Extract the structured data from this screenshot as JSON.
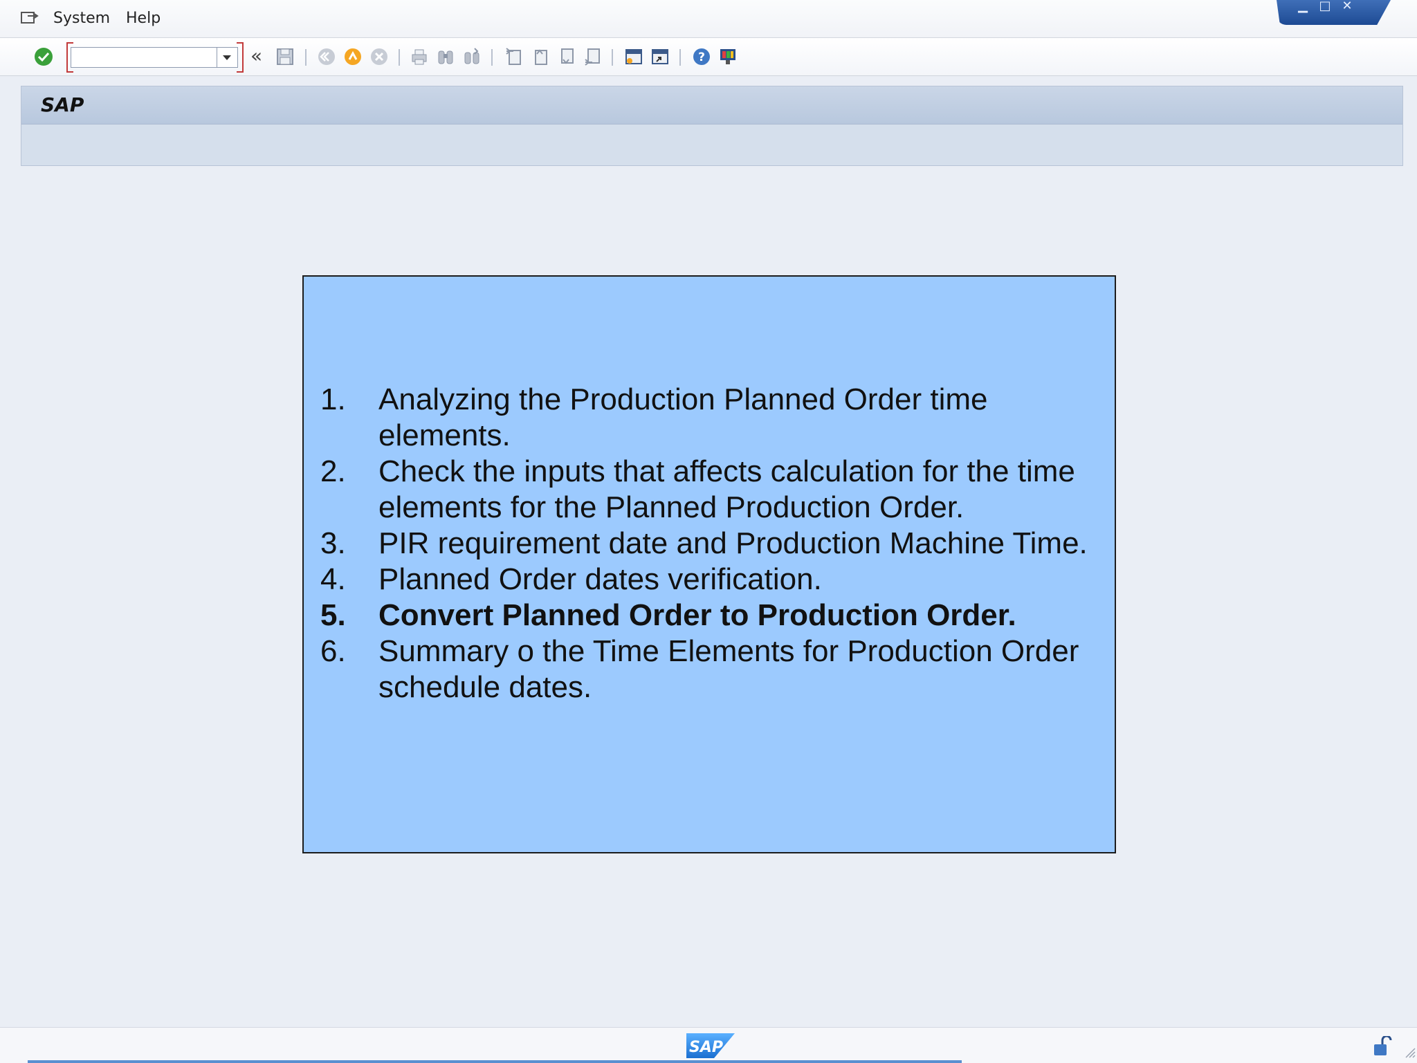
{
  "menubar": {
    "items": [
      {
        "label": "System"
      },
      {
        "label": "Help"
      }
    ]
  },
  "toolbar": {
    "command_field": {
      "value": "",
      "placeholder": ""
    },
    "icons": [
      "enter-icon",
      "save-icon",
      "back-icon",
      "exit-icon",
      "cancel-icon",
      "print-icon",
      "find-icon",
      "find-next-icon",
      "first-page-icon",
      "previous-page-icon",
      "next-page-icon",
      "last-page-icon",
      "create-session-icon",
      "shortcut-icon",
      "help-icon",
      "customize-layout-icon"
    ]
  },
  "title_area": {
    "title": "SAP"
  },
  "slide": {
    "steps": [
      {
        "num": "1.",
        "text": "Analyzing the Production Planned Order time elements.",
        "bold": false
      },
      {
        "num": "2.",
        "text": "Check the inputs that affects calculation for the time elements for the Planned Production Order.",
        "bold": false
      },
      {
        "num": "3.",
        "text": "PIR requirement date and Production Machine Time.",
        "bold": false
      },
      {
        "num": "4.",
        "text": "Planned Order dates verification.",
        "bold": false
      },
      {
        "num": "5.",
        "text": "Convert Planned Order to Production Order.",
        "bold": true
      },
      {
        "num": "6.",
        "text": "Summary o the Time Elements for Production Order schedule dates.",
        "bold": false
      }
    ],
    "background_color": "#9ccafe"
  },
  "statusbar": {
    "logo_text": "SAP"
  },
  "colors": {
    "accent": "#1d4a93",
    "window_bg": "#eaeef5",
    "enter_green": "#3aa03a"
  }
}
